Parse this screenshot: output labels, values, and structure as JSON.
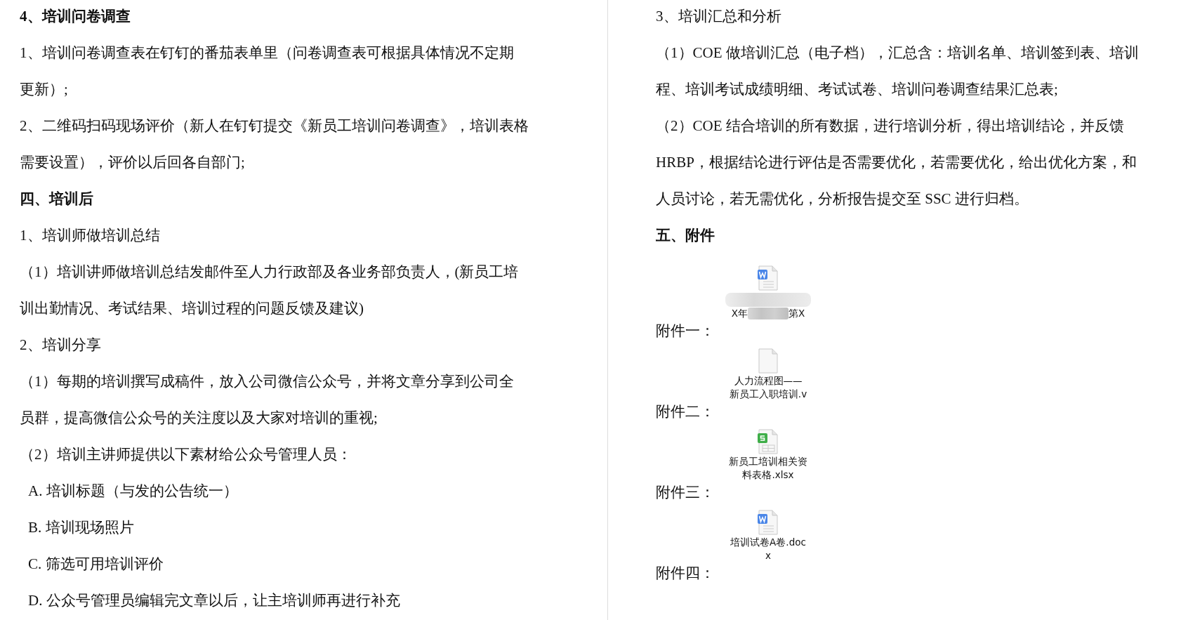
{
  "left_page": {
    "lines": [
      {
        "kind": "heading",
        "text": "4、培训问卷调查"
      },
      {
        "kind": "text",
        "text": "1、培训问卷调查表在钉钉的番茄表单里（问卷调查表可根据具体情况不定期"
      },
      {
        "kind": "text",
        "text": "更新）;"
      },
      {
        "kind": "text",
        "text": "2、二维码扫码现场评价（新人在钉钉提交《新员工培训问卷调查》，培训表格"
      },
      {
        "kind": "text",
        "text": "需要设置），评价以后回各自部门;"
      },
      {
        "kind": "heading",
        "text": "四、培训后"
      },
      {
        "kind": "text",
        "text": "1、培训师做培训总结"
      },
      {
        "kind": "text",
        "text": "（1）培训讲师做培训总结发邮件至人力行政部及各业务部负责人，(新员工培"
      },
      {
        "kind": "text",
        "text": "训出勤情况、考试结果、培训过程的问题反馈及建议)"
      },
      {
        "kind": "text",
        "text": "2、培训分享"
      },
      {
        "kind": "text",
        "text": "（1）每期的培训撰写成稿件，放入公司微信公众号，并将文章分享到公司全"
      },
      {
        "kind": "text",
        "text": "员群，提高微信公众号的关注度以及大家对培训的重视;"
      },
      {
        "kind": "text",
        "text": "（2）培训主讲师提供以下素材给公众号管理人员："
      },
      {
        "kind": "list",
        "text": "A. 培训标题（与发的公告统一）"
      },
      {
        "kind": "list",
        "text": "B. 培训现场照片"
      },
      {
        "kind": "list",
        "text": "C. 筛选可用培训评价"
      },
      {
        "kind": "list",
        "text": "D. 公众号管理员编辑完文章以后，让主培训师再进行补充"
      }
    ]
  },
  "right_page": {
    "lines": [
      {
        "kind": "text",
        "text": "3、培训汇总和分析"
      },
      {
        "kind": "text",
        "text": "（1）COE 做培训汇总（电子档），汇总含：培训名单、培训签到表、培训"
      },
      {
        "kind": "text",
        "text": "程、培训考试成绩明细、考试试卷、培训问卷调查结果汇总表;"
      },
      {
        "kind": "text",
        "text": "（2）COE 结合培训的所有数据，进行培训分析，得出培训结论，并反馈"
      },
      {
        "kind": "text",
        "text": "HRBP，根据结论进行评估是否需要优化，若需要优化，给出优化方案，和"
      },
      {
        "kind": "text",
        "text": "人员讨论，若无需优化，分析报告提交至 SSC 进行归档。"
      },
      {
        "kind": "heading",
        "text": "五、附件"
      }
    ],
    "attachments": [
      {
        "label": "附件一：",
        "kind": "word",
        "redacted": true,
        "file_name_lines": [
          "X年",
          "第X"
        ]
      },
      {
        "label": "附件二：",
        "kind": "blank",
        "redacted": false,
        "file_name_lines": [
          "人力流程图——",
          "新员工入职培训.v"
        ]
      },
      {
        "label": "附件三：",
        "kind": "sheet",
        "redacted": false,
        "file_name_lines": [
          "新员工培训相关资",
          "料表格.xlsx"
        ]
      },
      {
        "label": "附件四：",
        "kind": "word",
        "redacted": false,
        "file_name_lines": [
          "培训试卷A卷.doc",
          "x"
        ]
      }
    ]
  }
}
